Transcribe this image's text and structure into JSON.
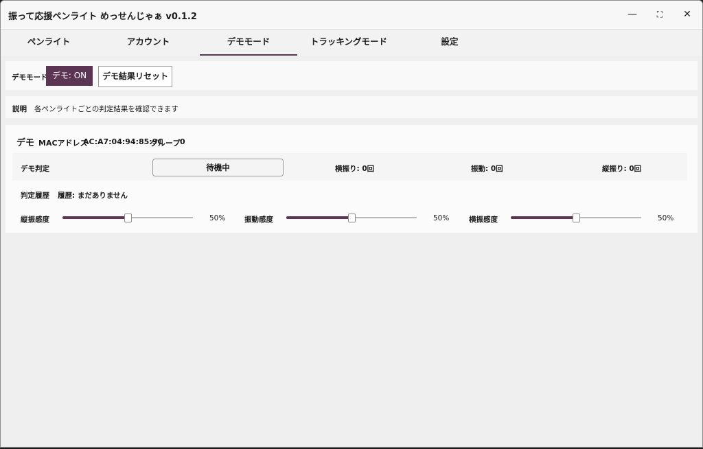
{
  "window": {
    "title": "振って応援ペンライト めっせんじゃぁ v0.1.2",
    "minimize_icon": "—",
    "maximize_icon": "⛶",
    "close_icon": "✕"
  },
  "tabs": [
    {
      "label": "ペンライト"
    },
    {
      "label": "アカウント"
    },
    {
      "label": "デモモード",
      "active": true
    },
    {
      "label": "トラッキングモード"
    },
    {
      "label": "設定"
    }
  ],
  "demo_bar": {
    "label": "デモモード",
    "on_button": "デモ: ON",
    "reset_button": "デモ結果リセット"
  },
  "description": {
    "label": "説明",
    "text": "各ペンライトごとの判定結果を確認できます"
  },
  "device": {
    "name": "デモ",
    "mac_label": "MACアドレス",
    "mac_value": "AC:A7:04:94:85:9C",
    "group_label": "グループ",
    "group_value": "0",
    "judge_label": "デモ判定",
    "status": "待機中",
    "counts": [
      "横振り: 0回",
      "振動: 0回",
      "縦振り: 0回"
    ],
    "history_label": "判定履歴",
    "history_text": "履歴: まだありません",
    "sliders": [
      {
        "label": "縦振感度",
        "value": 50,
        "value_text": "50%"
      },
      {
        "label": "振動感度",
        "value": 50,
        "value_text": "50%"
      },
      {
        "label": "横振感度",
        "value": 50,
        "value_text": "50%"
      }
    ]
  },
  "colors": {
    "accent": "#5b3553"
  }
}
